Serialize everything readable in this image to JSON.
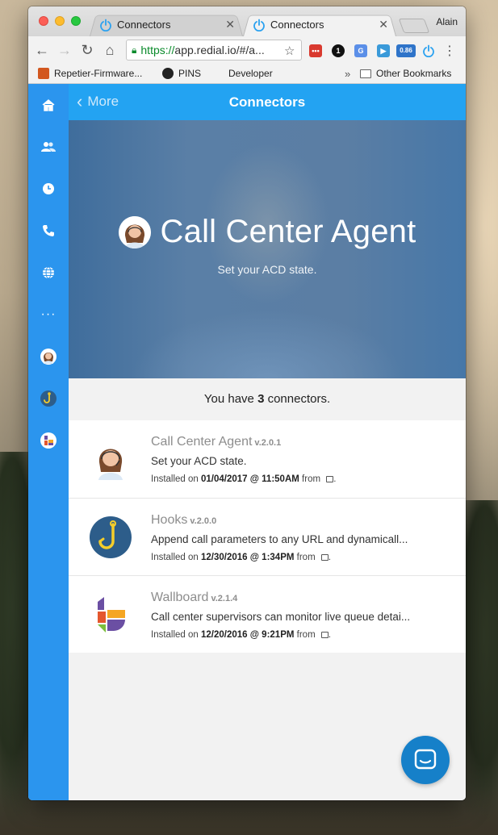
{
  "browser": {
    "tabs": [
      {
        "title": "Connectors"
      },
      {
        "title": "Connectors"
      }
    ],
    "profile_name": "Alain",
    "url_https": "https://",
    "url_rest": "app.redial.io/#/a...",
    "extension_badge": "0.86",
    "bookmarks": [
      {
        "label": "Repetier-Firmware..."
      },
      {
        "label": "PINS"
      },
      {
        "label": "Developer"
      }
    ],
    "other_bookmarks": "Other Bookmarks",
    "overflow_glyph": "»"
  },
  "app": {
    "topbar": {
      "back_label": "More",
      "title": "Connectors"
    },
    "hero": {
      "title": "Call Center Agent",
      "subtitle": "Set your ACD state."
    },
    "count": {
      "prefix": "You have ",
      "number": "3",
      "suffix": " connectors."
    },
    "connectors": [
      {
        "name": "Call Center Agent",
        "version": "v.2.0.1",
        "description": "Set your ACD state.",
        "installed_prefix": "Installed on ",
        "installed_date": "01/04/2017 @ 11:50AM",
        "from": " from "
      },
      {
        "name": "Hooks",
        "version": "v.2.0.0",
        "description": "Append call parameters to any URL and dynamicall...",
        "installed_prefix": "Installed on ",
        "installed_date": "12/30/2016 @ 1:34PM",
        "from": " from "
      },
      {
        "name": "Wallboard",
        "version": "v.2.1.4",
        "description": "Call center supervisors can monitor live queue detai...",
        "installed_prefix": "Installed on ",
        "installed_date": "12/20/2016 @ 9:21PM",
        "from": " from "
      }
    ]
  },
  "colors": {
    "sidebar": "#2b95ee",
    "topbar": "#23a3f2",
    "hero": "#4f78a2",
    "fab": "#1680c9"
  },
  "icons": {
    "sidebar": [
      "home-icon",
      "contacts-icon",
      "clock-icon",
      "phone-icon",
      "globe-icon",
      "more-icon",
      "agent-avatar-icon",
      "hooks-icon",
      "wallboard-icon"
    ]
  }
}
